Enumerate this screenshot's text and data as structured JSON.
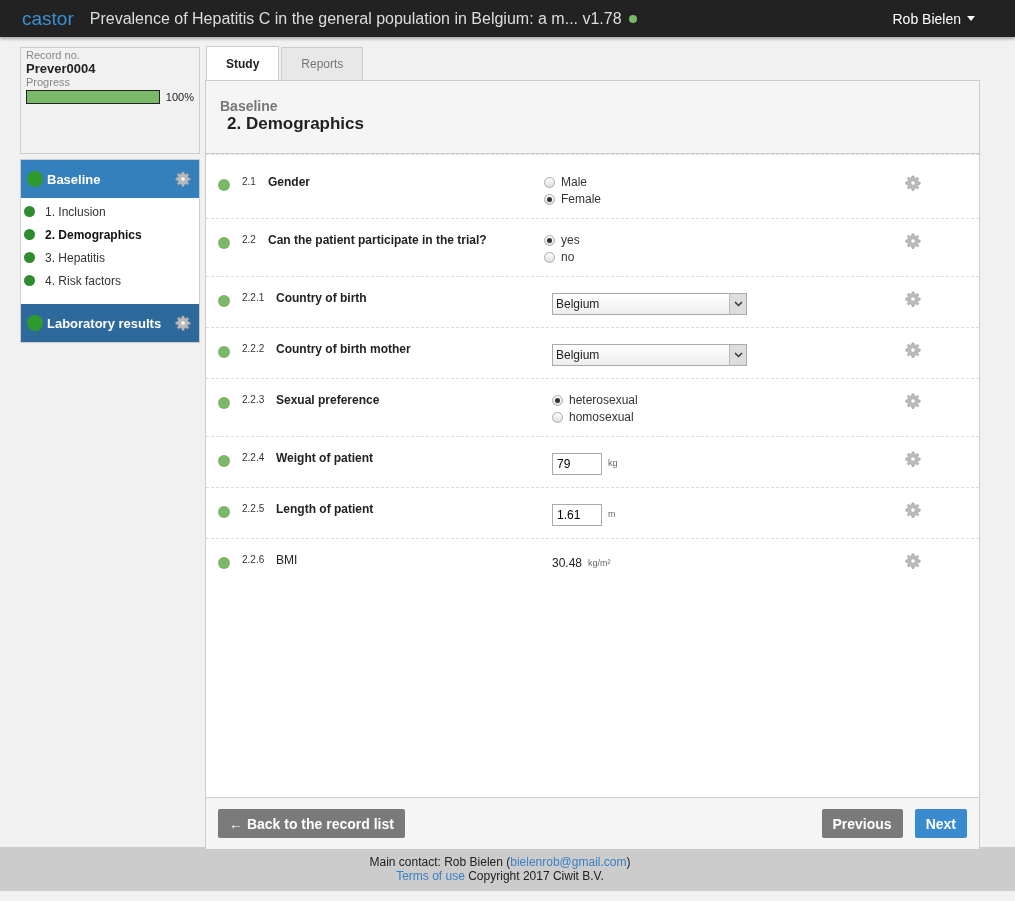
{
  "header": {
    "logo": "castor",
    "title": "Prevalence of Hepatitis C in the general population in Belgium: a m... v1.78",
    "user": "Rob Bielen"
  },
  "record": {
    "label": "Record no.",
    "number": "Prever0004",
    "progress_label": "Progress",
    "level": 1,
    "reading": "100%"
  },
  "sidebar": [
    {
      "title": "Baseline",
      "expanded": true,
      "items": [
        {
          "label": "1. Inclusion",
          "selected": false
        },
        {
          "label": "2. Demographics",
          "selected": true
        },
        {
          "label": "3. Hepatitis",
          "selected": false
        },
        {
          "label": "4. Risk factors",
          "selected": false
        }
      ]
    },
    {
      "title": "Laboratory results",
      "expanded": false
    }
  ],
  "tabs": [
    {
      "label": "Study",
      "selected": true
    },
    {
      "label": "Reports",
      "selected": false
    }
  ],
  "phase": "Baseline",
  "step": "2. Demographics",
  "fields": [
    {
      "kind": "radio",
      "number": "2.1",
      "label": "Gender",
      "options": [
        {
          "label": "Male",
          "selected": false
        },
        {
          "label": "Female",
          "selected": true
        }
      ]
    },
    {
      "kind": "radio",
      "number": "2.2",
      "label": "Can the patient participate in the trial?",
      "options": [
        {
          "label": "yes",
          "selected": true
        },
        {
          "label": "no",
          "selected": false
        }
      ]
    },
    {
      "kind": "select",
      "number": "2.2.1",
      "label": "Country of birth",
      "value": "Belgium"
    },
    {
      "kind": "select",
      "number": "2.2.2",
      "label": "Country of birth mother",
      "value": "Belgium"
    },
    {
      "kind": "radio",
      "number": "2.2.3",
      "label": "Sexual preference",
      "options": [
        {
          "label": "heterosexual",
          "selected": true
        },
        {
          "label": "homosexual",
          "selected": false
        }
      ]
    },
    {
      "kind": "number",
      "number": "2.2.4",
      "label": "Weight of patient",
      "value": "79",
      "unit": "kg"
    },
    {
      "kind": "number",
      "number": "2.2.5",
      "label": "Length of patient",
      "value": "1.61",
      "unit": "m"
    },
    {
      "kind": "calc",
      "number": "2.2.6",
      "label": "BMI",
      "value": "30.48",
      "unit": "kg/m²"
    }
  ],
  "buttons": {
    "back": "← Back to the record list",
    "previous": "Previous",
    "next": "Next"
  },
  "footer": {
    "contact_prefix": "Main contact: Rob Bielen (",
    "email": "bielenrob@gmail.com",
    "contact_suffix": ")",
    "terms": "Terms of use",
    "copyright": "Copyright 2017 Ciwit B.V."
  }
}
